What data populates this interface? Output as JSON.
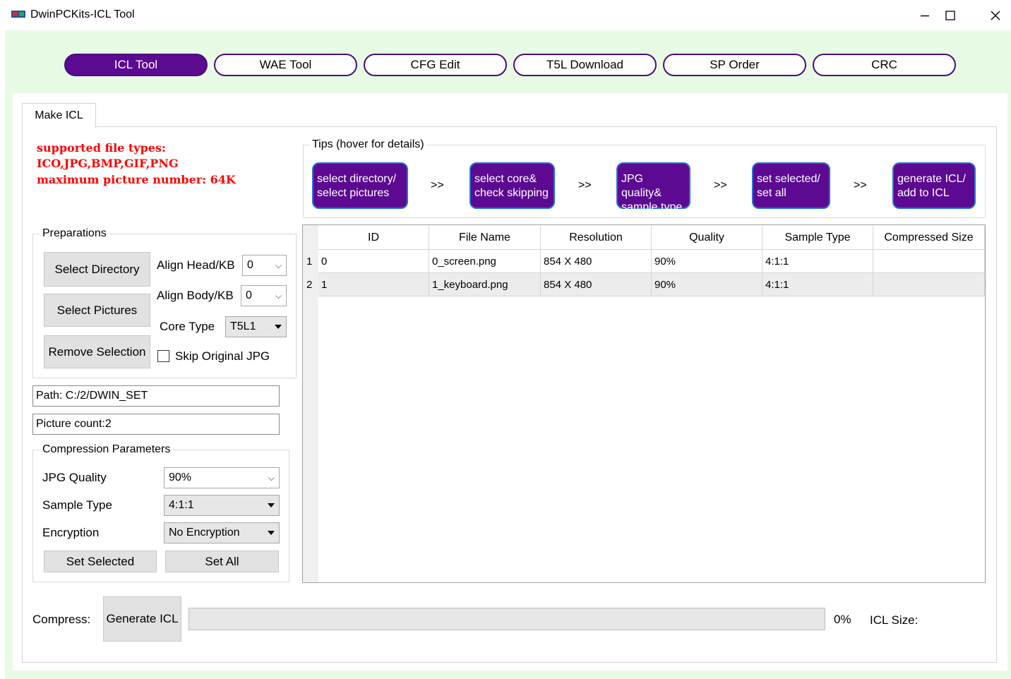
{
  "window": {
    "title": "DwinPCKits-ICL Tool",
    "minimize": "—",
    "maximize": "☐",
    "close": "✕"
  },
  "nav": {
    "tabs": [
      {
        "label": "ICL Tool",
        "active": true
      },
      {
        "label": "WAE Tool",
        "active": false
      },
      {
        "label": "CFG Edit",
        "active": false
      },
      {
        "label": "T5L Download",
        "active": false
      },
      {
        "label": "SP Order",
        "active": false
      },
      {
        "label": "CRC",
        "active": false
      }
    ],
    "active_color": "#5c0a92"
  },
  "tab": {
    "label": "Make ICL"
  },
  "info": {
    "line1": "supported file types:",
    "line2": "ICO,JPG,BMP,GIF,PNG",
    "line3": "maximum picture number: 64K",
    "color": "#ff0000"
  },
  "tips": {
    "title": "Tips (hover for details)",
    "steps": [
      {
        "line1": "select directory/",
        "line2": "select pictures"
      },
      {
        "line1": "select core&",
        "line2": "check skipping"
      },
      {
        "line1": "JPG quality&",
        "line2": "sample type"
      },
      {
        "line1": "set selected/",
        "line2": "set all"
      },
      {
        "line1": "generate ICL/",
        "line2": "add to ICL"
      }
    ],
    "arrow": ">>"
  },
  "preparations": {
    "title": "Preparations",
    "select_directory": "Select Directory",
    "select_pictures": "Select Pictures",
    "remove_selection": "Remove Selection",
    "align_head_label": "Align Head/KB",
    "align_head_value": "0",
    "align_body_label": "Align Body/KB",
    "align_body_value": "0",
    "core_type_label": "Core Type",
    "core_type_value": "T5L1",
    "skip_jpg_label": "Skip Original JPG",
    "skip_jpg_checked": false
  },
  "path": {
    "text": "Path: C:/2/DWIN_SET"
  },
  "count": {
    "text": "Picture count:2"
  },
  "compression": {
    "title": "Compression Parameters",
    "jpg_quality_label": "JPG Quality",
    "jpg_quality_value": "90%",
    "sample_type_label": "Sample Type",
    "sample_type_value": "4:1:1",
    "encryption_label": "Encryption",
    "encryption_value": "No Encryption",
    "set_selected": "Set Selected",
    "set_all": "Set All"
  },
  "table": {
    "columns": [
      "ID",
      "File Name",
      "Resolution",
      "Quality",
      "Sample Type",
      "Compressed Size"
    ],
    "rows": [
      {
        "num": "1",
        "id": "0",
        "file": "0_screen.png",
        "res": "854 X 480",
        "quality": "90%",
        "sample": "4:1:1",
        "size": ""
      },
      {
        "num": "2",
        "id": "1",
        "file": "1_keyboard.png",
        "res": "854 X 480",
        "quality": "90%",
        "sample": "4:1:1",
        "size": ""
      }
    ]
  },
  "compress": {
    "label": "Compress:",
    "generate": "Generate ICL",
    "progress_fraction": 0,
    "percent": "0%",
    "icl_size_label": "ICL Size:"
  }
}
